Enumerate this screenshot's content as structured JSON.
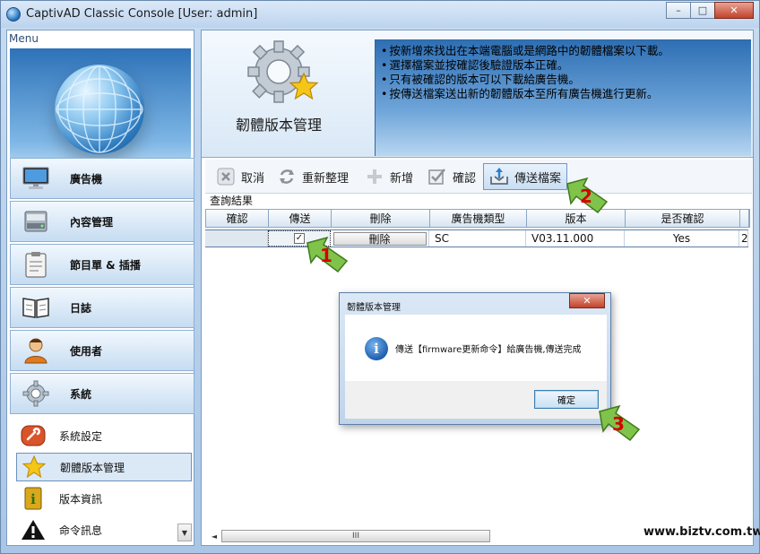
{
  "window": {
    "title": "CaptivAD Classic Console [User: admin]",
    "minimize": "–",
    "maximize": "□",
    "close": "✕"
  },
  "menu": {
    "label": "Menu",
    "buttons": [
      {
        "label": "廣告機",
        "icon": "monitor-icon"
      },
      {
        "label": "內容管理",
        "icon": "disk-drive-icon"
      },
      {
        "label": "節目單 & 插播",
        "icon": "clipboard-icon"
      },
      {
        "label": "日誌",
        "icon": "book-icon"
      },
      {
        "label": "使用者",
        "icon": "user-icon"
      },
      {
        "label": "系統",
        "icon": "gear-icon"
      }
    ],
    "sub_items": [
      {
        "label": "系統設定",
        "icon": "wrench-icon"
      },
      {
        "label": "韌體版本管理",
        "icon": "star-icon"
      },
      {
        "label": "版本資訊",
        "icon": "info-book-icon"
      },
      {
        "label": "命令訊息",
        "icon": "warning-icon"
      }
    ],
    "scroll_down": "▼"
  },
  "header": {
    "title": "韌體版本管理",
    "info_lines": [
      "按新增來找出在本端電腦或是網路中的韌體檔案以下載。",
      "選擇檔案並按確認後驗證版本正確。",
      "只有被確認的版本可以下載給廣告機。",
      "按傳送檔案送出新的韌體版本至所有廣告機進行更新。"
    ]
  },
  "toolbar": {
    "cancel": "取消",
    "refresh": "重新整理",
    "add": "新增",
    "confirm": "確認",
    "send_file": "傳送檔案"
  },
  "grid": {
    "label": "查詢結果",
    "columns": [
      "確認",
      "傳送",
      "刪除",
      "廣告機類型",
      "版本",
      "是否確認",
      ""
    ],
    "rows": [
      {
        "confirm": "",
        "send": "✓",
        "delete": "刪除",
        "type": "SC",
        "version": "V03.11.000",
        "confirmed": "Yes",
        "extra": "2"
      }
    ],
    "scroll_grip": "III",
    "scroll_left": "◄"
  },
  "watermark": "www.biztv.com.tw",
  "dialog": {
    "title": "韌體版本管理",
    "close": "✕",
    "icon_glyph": "i",
    "message": "傳送【firmware更新命令】給廣告機,傳送完成",
    "ok": "確定"
  },
  "callouts": [
    "1",
    "2",
    "3"
  ]
}
